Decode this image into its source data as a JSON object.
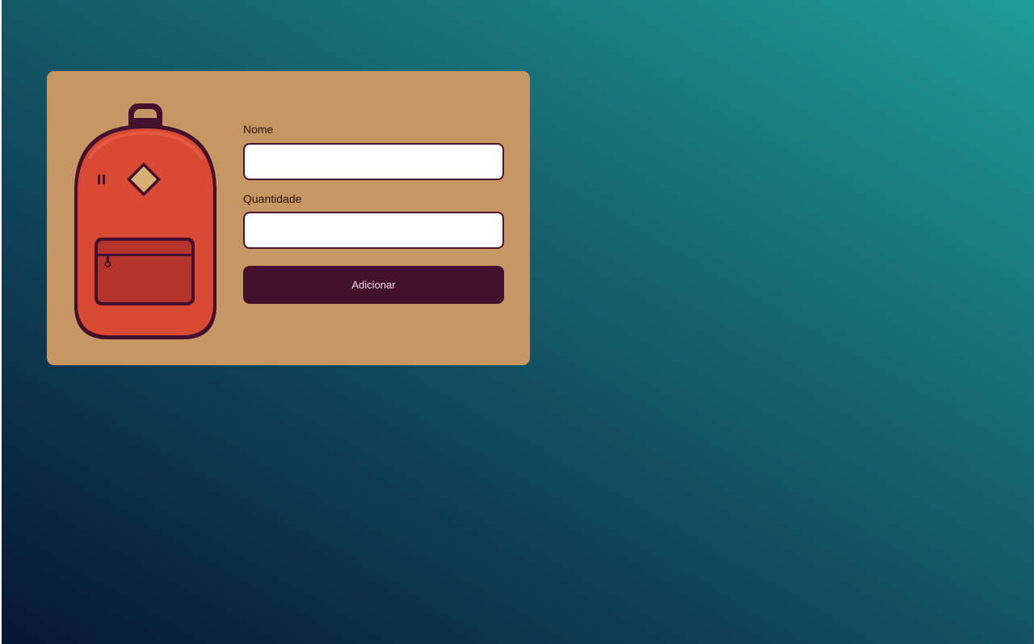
{
  "form": {
    "name_label": "Nome",
    "name_value": "",
    "quantity_label": "Quantidade",
    "quantity_value": "",
    "submit_label": "Adicionar"
  },
  "illustration": {
    "icon": "backpack-icon"
  },
  "colors": {
    "card_background": "#c69663",
    "button_background": "#43102e",
    "input_border": "#4c1430",
    "backpack_body": "#d94a35",
    "backpack_outline": "#43102e"
  }
}
